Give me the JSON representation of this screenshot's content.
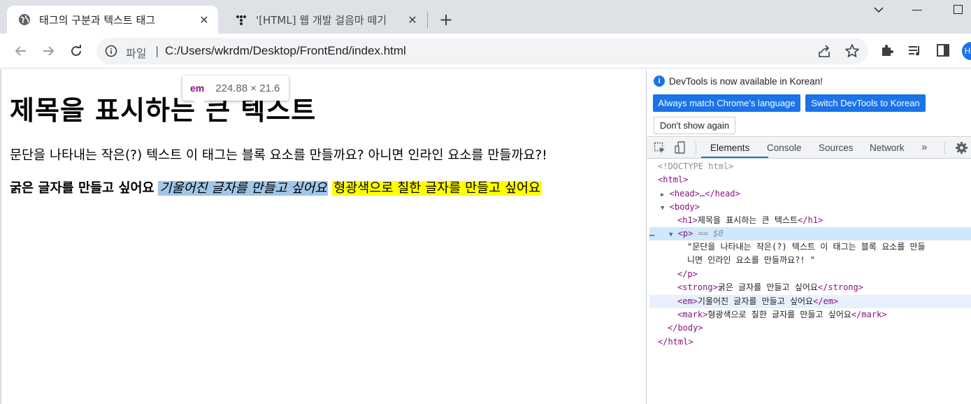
{
  "browser": {
    "tabs": [
      {
        "title": "태그의 구분과 텍스트 태그",
        "active": true,
        "close": "✕"
      },
      {
        "title": "'[HTML] 웹 개발 걸음마 떼기",
        "active": false,
        "close": "✕"
      }
    ],
    "new_tab": "+",
    "toolbar": {
      "scheme_label": "파일",
      "separator": "|",
      "url": "C:/Users/wkrdm/Desktop/FrontEnd/index.html"
    },
    "profile_initial": "H"
  },
  "page": {
    "heading": "제목을 표시하는 큰 텍스트",
    "paragraph": "문단을 나타내는 작은(?) 텍스트 이 태그는 블록 요소를 만들까요? 아니면 인라인 요소를 만들까요?!",
    "strong_text": "굵은 글자를 만들고 싶어요",
    "em_text": "기울어진 글자를 만들고 싶어요",
    "mark_text": "형광색으로 칠한 글자를 만들고 싶어요",
    "tooltip": {
      "tag": "em",
      "dims": "224.88 × 21.6"
    }
  },
  "devtools": {
    "infobar": {
      "message": "DevTools is now available in Korean!",
      "buttons": [
        "Always match Chrome's language",
        "Switch DevTools to Korean",
        "Don't show again"
      ]
    },
    "tabs": [
      "Elements",
      "Console",
      "Sources",
      "Network"
    ],
    "active_tab": "Elements",
    "more_tabs": "»",
    "dom": {
      "doctype": "<!DOCTYPE html>",
      "html_open": "<html>",
      "head": "<head>…</head>",
      "body_open": "<body>",
      "h1_open": "<h1>",
      "h1_text": "제목을 표시하는 큰 텍스트",
      "h1_close": "</h1>",
      "p_open": "<p>",
      "p_marker": " == $0",
      "p_text_1": "\"문단을 나타내는 작은(?) 텍스트 이 태그는 블록 요소를 만들",
      "p_text_2": "니면 인라인 요소를 만들까요?! \"",
      "p_close": "</p>",
      "strong_open": "<strong>",
      "strong_text": "굵은 글자를 만들고 싶어요",
      "strong_close": "</strong>",
      "em_open": "<em>",
      "em_text": "기울어진 글자를 만들고 싶어요",
      "em_close": "</em>",
      "mark_open": "<mark>",
      "mark_text": "형광색으로 칠한 글자를 만들고 싶어요",
      "mark_close": "</mark>",
      "body_close": "</body>",
      "html_close": "</html>",
      "ellipsis": "…"
    }
  },
  "colors": {
    "accent": "#1a73e8",
    "tag_purple": "#881280",
    "highlight_em": "#6fa8dc",
    "mark_yellow": "#ffff00",
    "selected_row": "#cfe8fc"
  }
}
